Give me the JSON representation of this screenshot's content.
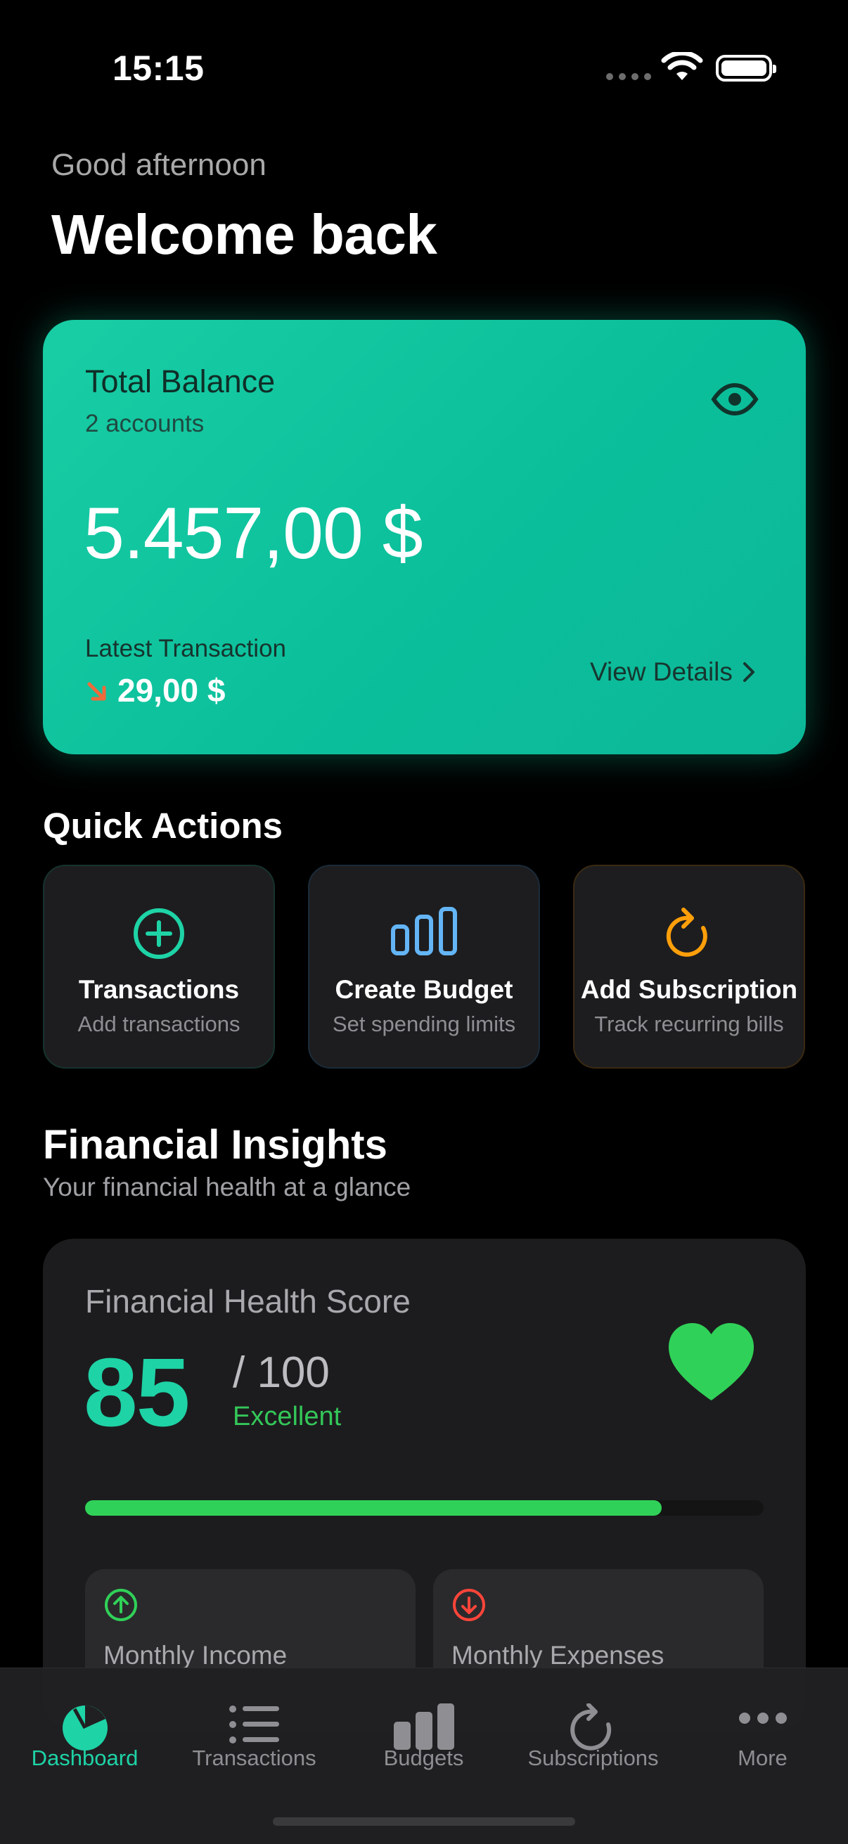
{
  "status_bar": {
    "time": "15:15"
  },
  "header": {
    "greeting": "Good afternoon",
    "title": "Welcome back"
  },
  "balance_card": {
    "title": "Total Balance",
    "subtitle": "2 accounts",
    "amount": "5.457,00 $",
    "latest_label": "Latest Transaction",
    "latest_amount": "29,00 $",
    "view_details": "View Details",
    "icons": {
      "visibility": "eye-icon",
      "direction": "arrow-down-right-icon",
      "chevron": "chevron-right-icon"
    }
  },
  "quick_actions": {
    "title": "Quick Actions",
    "items": [
      {
        "title": "Transactions",
        "subtitle": "Add transactions",
        "icon": "plus-circle-icon",
        "color": "#1ed3a6"
      },
      {
        "title": "Create Budget",
        "subtitle": "Set spending limits",
        "icon": "chart-bars-icon",
        "color": "#64b5f6"
      },
      {
        "title": "Add Subscription",
        "subtitle": "Track recurring bills",
        "icon": "refresh-icon",
        "color": "#ff9f0a"
      }
    ]
  },
  "insights": {
    "title": "Financial Insights",
    "subtitle": "Your financial health at a glance",
    "health": {
      "title": "Financial Health Score",
      "score": "85",
      "max": "/ 100",
      "rating": "Excellent",
      "progress": 0.85,
      "icon": "heart-icon",
      "colors": {
        "score": "#1ed3a6",
        "progress": "#30d158",
        "heart": "#30d158"
      }
    },
    "income": {
      "label": "Monthly Income",
      "icon": "arrow-up-circle-icon",
      "color": "#30d158"
    },
    "expenses": {
      "label": "Monthly Expenses",
      "icon": "arrow-down-circle-icon",
      "color": "#ff453a"
    }
  },
  "tab_bar": {
    "active": "Dashboard",
    "active_color": "#1ed3a6",
    "items": [
      {
        "label": "Dashboard",
        "icon": "pie-chart-icon"
      },
      {
        "label": "Transactions",
        "icon": "list-icon"
      },
      {
        "label": "Budgets",
        "icon": "bar-chart-icon"
      },
      {
        "label": "Subscriptions",
        "icon": "refresh-icon"
      },
      {
        "label": "More",
        "icon": "more-icon"
      }
    ]
  }
}
